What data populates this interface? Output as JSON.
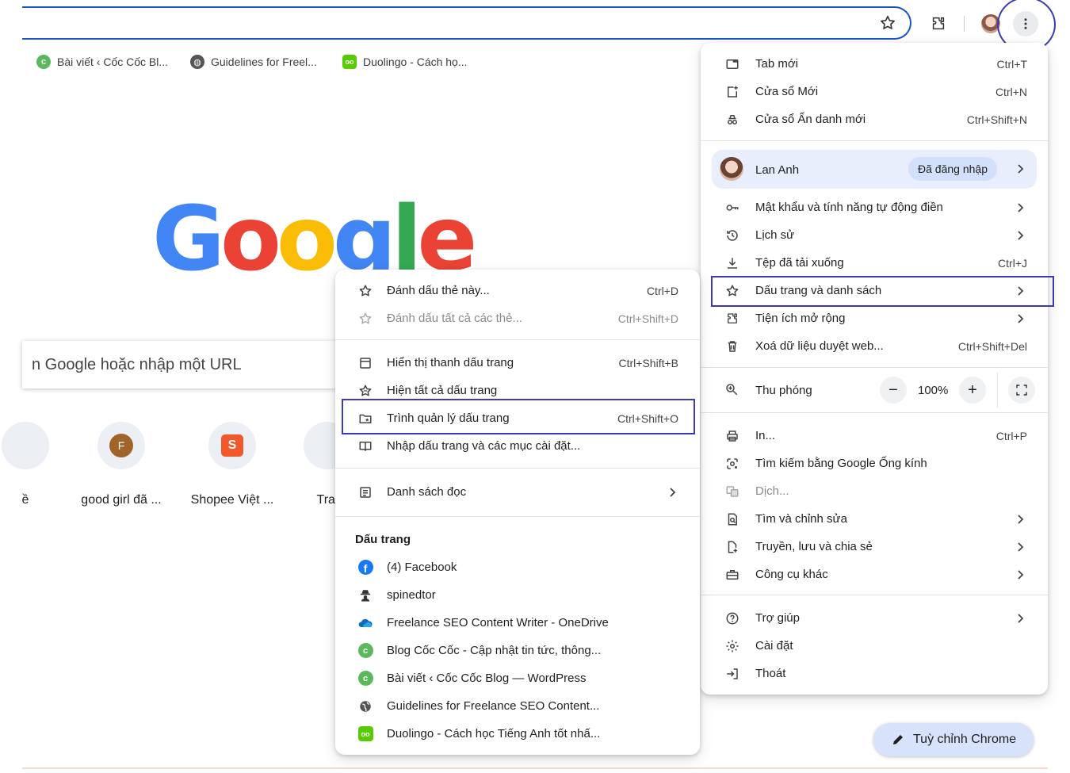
{
  "toolbar": {
    "star_icon": "bookmark-star-icon",
    "extensions_icon": "puzzle-icon",
    "avatar_icon": "profile-avatar",
    "menu_icon": "three-dots-vertical-icon"
  },
  "bookmarks_bar": [
    {
      "label": "Bài viết ‹ Cốc Cốc Bl...",
      "icon": "coccoc-icon"
    },
    {
      "label": "Guidelines for Freel...",
      "icon": "globe-icon"
    },
    {
      "label": "Duolingo - Cách họ...",
      "icon": "duolingo-icon"
    }
  ],
  "new_tab": {
    "logo_letters": [
      "G",
      "o",
      "o",
      "g",
      "l",
      "e"
    ],
    "search_placeholder": "n Google hoặc nhập một URL",
    "shortcuts": [
      {
        "label": "ề",
        "letter": ""
      },
      {
        "label": "good girl đã ...",
        "letter": "F"
      },
      {
        "label": "Shopee Việt ...",
        "letter": "S"
      },
      {
        "label": "Trai",
        "letter": ""
      }
    ],
    "customize_label": "Tuỳ chỉnh Chrome"
  },
  "chrome_menu": {
    "group1": [
      {
        "label": "Tab mới",
        "shortcut": "Ctrl+T",
        "icon": "new-tab-icon"
      },
      {
        "label": "Cửa sổ Mới",
        "shortcut": "Ctrl+N",
        "icon": "new-window-icon"
      },
      {
        "label": "Cửa sổ Ẩn danh mới",
        "shortcut": "Ctrl+Shift+N",
        "icon": "incognito-icon"
      }
    ],
    "profile": {
      "name": "Lan Anh",
      "status": "Đã đăng nhập"
    },
    "group2": [
      {
        "label": "Mật khẩu và tính năng tự động điền",
        "shortcut": "",
        "icon": "key-icon",
        "submenu": true
      },
      {
        "label": "Lịch sử",
        "shortcut": "",
        "icon": "history-icon",
        "submenu": true
      },
      {
        "label": "Tệp đã tải xuống",
        "shortcut": "Ctrl+J",
        "icon": "download-icon",
        "submenu": false
      },
      {
        "label": "Dấu trang và danh sách",
        "shortcut": "",
        "icon": "star-icon",
        "submenu": true
      },
      {
        "label": "Tiện ích mở rộng",
        "shortcut": "",
        "icon": "puzzle-icon",
        "submenu": true
      },
      {
        "label": "Xoá dữ liệu duyệt web...",
        "shortcut": "Ctrl+Shift+Del",
        "icon": "trash-icon",
        "submenu": false
      }
    ],
    "zoom": {
      "label": "Thu phóng",
      "value": "100%",
      "minus": "−",
      "plus": "+"
    },
    "group3": [
      {
        "label": "In...",
        "shortcut": "Ctrl+P",
        "icon": "print-icon",
        "submenu": false,
        "dim": false
      },
      {
        "label": "Tìm kiếm bằng Google Ống kính",
        "shortcut": "",
        "icon": "lens-icon",
        "submenu": false,
        "dim": false
      },
      {
        "label": "Dịch...",
        "shortcut": "",
        "icon": "translate-icon",
        "submenu": false,
        "dim": true
      },
      {
        "label": "Tìm và chỉnh sửa",
        "shortcut": "",
        "icon": "find-icon",
        "submenu": true,
        "dim": false
      },
      {
        "label": "Truyền, lưu và chia sẻ",
        "shortcut": "",
        "icon": "cast-icon",
        "submenu": true,
        "dim": false
      },
      {
        "label": "Công cụ khác",
        "shortcut": "",
        "icon": "toolbox-icon",
        "submenu": true,
        "dim": false
      }
    ],
    "group4": [
      {
        "label": "Trợ giúp",
        "icon": "help-icon",
        "submenu": true
      },
      {
        "label": "Cài đặt",
        "icon": "settings-icon",
        "submenu": false
      },
      {
        "label": "Thoát",
        "icon": "exit-icon",
        "submenu": false
      }
    ]
  },
  "bookmarks_submenu": {
    "group1": [
      {
        "label": "Đánh dấu thẻ này...",
        "shortcut": "Ctrl+D",
        "icon": "star-icon",
        "dim": false
      },
      {
        "label": "Đánh dấu tất cả các thẻ...",
        "shortcut": "Ctrl+Shift+D",
        "icon": "star-multi-icon",
        "dim": true
      }
    ],
    "group2": [
      {
        "label": "Hiển thị thanh dấu trang",
        "shortcut": "Ctrl+Shift+B",
        "icon": "bookmark-bar-icon"
      },
      {
        "label": "Hiện tất cả dấu trang",
        "shortcut": "",
        "icon": "stars-icon"
      },
      {
        "label": "Trình quản lý dấu trang",
        "shortcut": "Ctrl+Shift+O",
        "icon": "folder-star-icon"
      },
      {
        "label": "Nhập dấu trang và các mục cài đặt...",
        "shortcut": "",
        "icon": "import-book-icon"
      }
    ],
    "reading_list": {
      "label": "Danh sách đọc",
      "icon": "reading-list-icon"
    },
    "bookmarks_heading": "Dấu trang",
    "bookmarks": [
      {
        "label": "(4) Facebook",
        "icon": "facebook-icon"
      },
      {
        "label": "spinedtor",
        "icon": "spy-icon"
      },
      {
        "label": "Freelance SEO Content Writer - OneDrive",
        "icon": "onedrive-icon"
      },
      {
        "label": "Blog Cốc Cốc - Cập nhật tin tức, thông...",
        "icon": "coccoc-icon"
      },
      {
        "label": "Bài viết ‹ Cốc Cốc Blog — WordPress",
        "icon": "coccoc-icon"
      },
      {
        "label": "Guidelines for Freelance SEO Content...",
        "icon": "globe-icon"
      },
      {
        "label": "Duolingo - Cách học Tiếng Anh tốt nhấ...",
        "icon": "duolingo-icon"
      }
    ]
  },
  "colors": {
    "accent": "#1a56c8",
    "highlight_box": "#3a3ab8",
    "profile_pill": "#e8eefb",
    "customize_bg": "#d6e3fb"
  }
}
